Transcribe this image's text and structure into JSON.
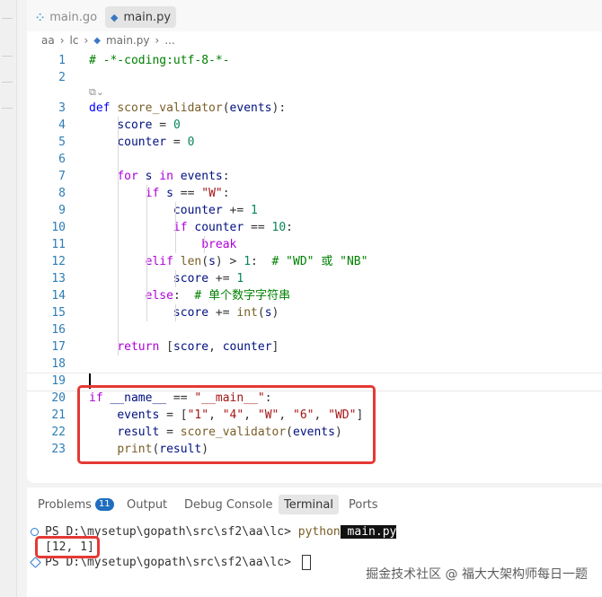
{
  "tabs": [
    {
      "icon": "go-file-icon",
      "label": "main.go",
      "active": false
    },
    {
      "icon": "python-file-icon",
      "label": "main.py",
      "active": true
    }
  ],
  "breadcrumb": {
    "parts": [
      "aa",
      "lc",
      "main.py",
      "..."
    ]
  },
  "code_lines": [
    {
      "n": "1",
      "text": "# -*-coding:utf-8-*-"
    },
    {
      "n": "2",
      "text": ""
    },
    {
      "n": "3",
      "text": "def score_validator(events):"
    },
    {
      "n": "4",
      "text": "    score = 0"
    },
    {
      "n": "5",
      "text": "    counter = 0"
    },
    {
      "n": "6",
      "text": ""
    },
    {
      "n": "7",
      "text": "    for s in events:"
    },
    {
      "n": "8",
      "text": "        if s == \"W\":"
    },
    {
      "n": "9",
      "text": "            counter += 1"
    },
    {
      "n": "10",
      "text": "            if counter == 10:"
    },
    {
      "n": "11",
      "text": "                break"
    },
    {
      "n": "12",
      "text": "        elif len(s) > 1:  # \"WD\" 或 \"NB\""
    },
    {
      "n": "13",
      "text": "            score += 1"
    },
    {
      "n": "14",
      "text": "        else:  # 单个数字字符串"
    },
    {
      "n": "15",
      "text": "            score += int(s)"
    },
    {
      "n": "16",
      "text": ""
    },
    {
      "n": "17",
      "text": "    return [score, counter]"
    },
    {
      "n": "18",
      "text": ""
    },
    {
      "n": "19",
      "text": ""
    },
    {
      "n": "20",
      "text": "if __name__ == \"__main__\":"
    },
    {
      "n": "21",
      "text": "    events = [\"1\", \"4\", \"W\", \"6\", \"WD\"]"
    },
    {
      "n": "22",
      "text": "    result = score_validator(events)"
    },
    {
      "n": "23",
      "text": "    print(result)"
    }
  ],
  "panel": {
    "tabs": [
      {
        "label": "Problems",
        "badge": "11"
      },
      {
        "label": "Output"
      },
      {
        "label": "Debug Console"
      },
      {
        "label": "Terminal",
        "active": true
      },
      {
        "label": "Ports"
      }
    ],
    "terminal": {
      "line1_prompt": "PS D:\\mysetup\\gopath\\src\\sf2\\aa\\lc> ",
      "line1_cmd": "python",
      "line1_file": " main.py",
      "line2": "[12, 1]",
      "line3_prompt": "PS D:\\mysetup\\gopath\\src\\sf2\\aa\\lc> "
    }
  },
  "watermark": "掘金技术社区 @ 福大大架构师每日一题",
  "colors": {
    "highlight_box": "#e53935",
    "accent": "#1f6fbf"
  }
}
